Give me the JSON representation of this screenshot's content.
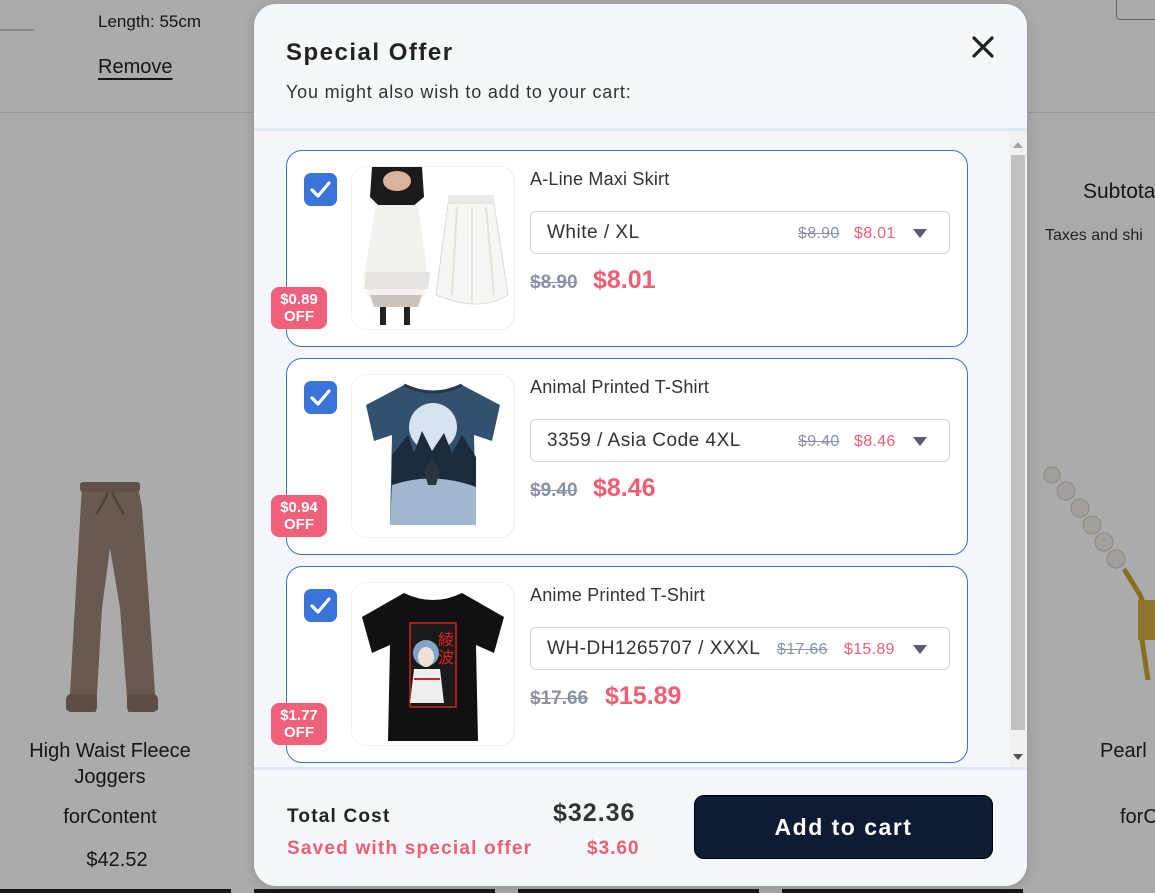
{
  "background": {
    "cart_item": {
      "length_text": "Length: 55cm",
      "remove_label": "Remove"
    },
    "summary": {
      "subtotal_label": "Subtotal",
      "taxes_text": "Taxes and shi"
    },
    "products": [
      {
        "name": "High Waist Fleece Joggers",
        "vendor": "forContent",
        "price": "$42.52",
        "image_icon": "joggers-image"
      },
      {
        "name": "Pearl",
        "vendor": "forC",
        "price": "",
        "image_icon": "pearl-necklace-image"
      }
    ]
  },
  "modal": {
    "title": "Special Offer",
    "subtitle": "You might also wish to add to your cart:",
    "close_icon": "close-icon",
    "items": [
      {
        "name": "A-Line Maxi Skirt",
        "checked": true,
        "badge_amount": "$0.89",
        "badge_text": "OFF",
        "variant": "White / XL",
        "variant_old_price": "$8.90",
        "variant_new_price": "$8.01",
        "old_price": "$8.90",
        "new_price": "$8.01",
        "image_icon": "skirt-image"
      },
      {
        "name": "Animal Printed T-Shirt",
        "checked": true,
        "badge_amount": "$0.94",
        "badge_text": "OFF",
        "variant": "3359 / Asia Code 4XL",
        "variant_old_price": "$9.40",
        "variant_new_price": "$8.46",
        "old_price": "$9.40",
        "new_price": "$8.46",
        "image_icon": "wolf-tshirt-image"
      },
      {
        "name": "Anime Printed T-Shirt",
        "checked": true,
        "badge_amount": "$1.77",
        "badge_text": "OFF",
        "variant": "WH-DH1265707 / XXXL",
        "variant_old_price": "$17.66",
        "variant_new_price": "$15.89",
        "old_price": "$17.66",
        "new_price": "$15.89",
        "image_icon": "anime-tshirt-image"
      }
    ],
    "footer": {
      "total_label": "Total Cost",
      "total_value": "$32.36",
      "saved_label": "Saved with special offer",
      "saved_value": "$3.60",
      "add_button": "Add to cart"
    }
  },
  "colors": {
    "accent_blue": "#3b74d9",
    "sale_red": "#ef5e73",
    "button_navy": "#0f1a33",
    "modal_bg": "#f4f7fb"
  }
}
